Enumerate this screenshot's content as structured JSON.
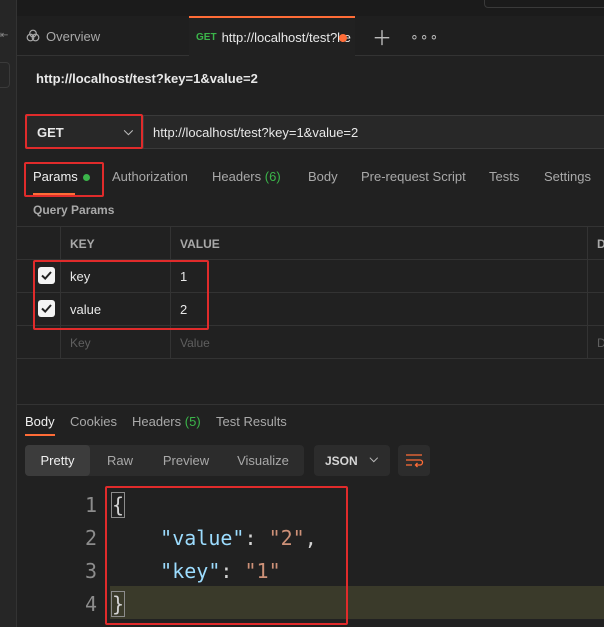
{
  "tabs": {
    "overview_label": "Overview",
    "request_method": "GET",
    "request_label": "http://localhost/test?ke"
  },
  "request": {
    "title": "http://localhost/test?key=1&value=2",
    "method": "GET",
    "url": "http://localhost/test?key=1&value=2"
  },
  "request_tabs": {
    "params": "Params",
    "authorization": "Authorization",
    "headers": "Headers",
    "headers_count": "(6)",
    "body": "Body",
    "prerequest": "Pre-request Script",
    "tests": "Tests",
    "settings": "Settings"
  },
  "query_params": {
    "label": "Query Params",
    "headers": {
      "key": "KEY",
      "value": "VALUE",
      "desc": "D"
    },
    "rows": [
      {
        "key": "key",
        "value": "1",
        "checked": true
      },
      {
        "key": "value",
        "value": "2",
        "checked": true
      }
    ],
    "placeholder": {
      "key": "Key",
      "value": "Value",
      "desc": "D"
    }
  },
  "response_tabs": {
    "body": "Body",
    "cookies": "Cookies",
    "headers": "Headers",
    "headers_count": "(5)",
    "test_results": "Test Results"
  },
  "view": {
    "pretty": "Pretty",
    "raw": "Raw",
    "preview": "Preview",
    "visualize": "Visualize",
    "format": "JSON"
  },
  "response_body": {
    "line_numbers": [
      "1",
      "2",
      "3",
      "4"
    ],
    "open_brace": "{",
    "close_brace": "}",
    "entries": [
      {
        "key": "\"value\"",
        "value": "\"2\"",
        "sep": ": ",
        "trail": ","
      },
      {
        "key": "\"key\"",
        "value": "\"1\"",
        "sep": ": ",
        "trail": ""
      }
    ]
  },
  "colors": {
    "accent": "#ff6c37",
    "success": "#3bb54a",
    "highlight": "#e02b2b"
  }
}
